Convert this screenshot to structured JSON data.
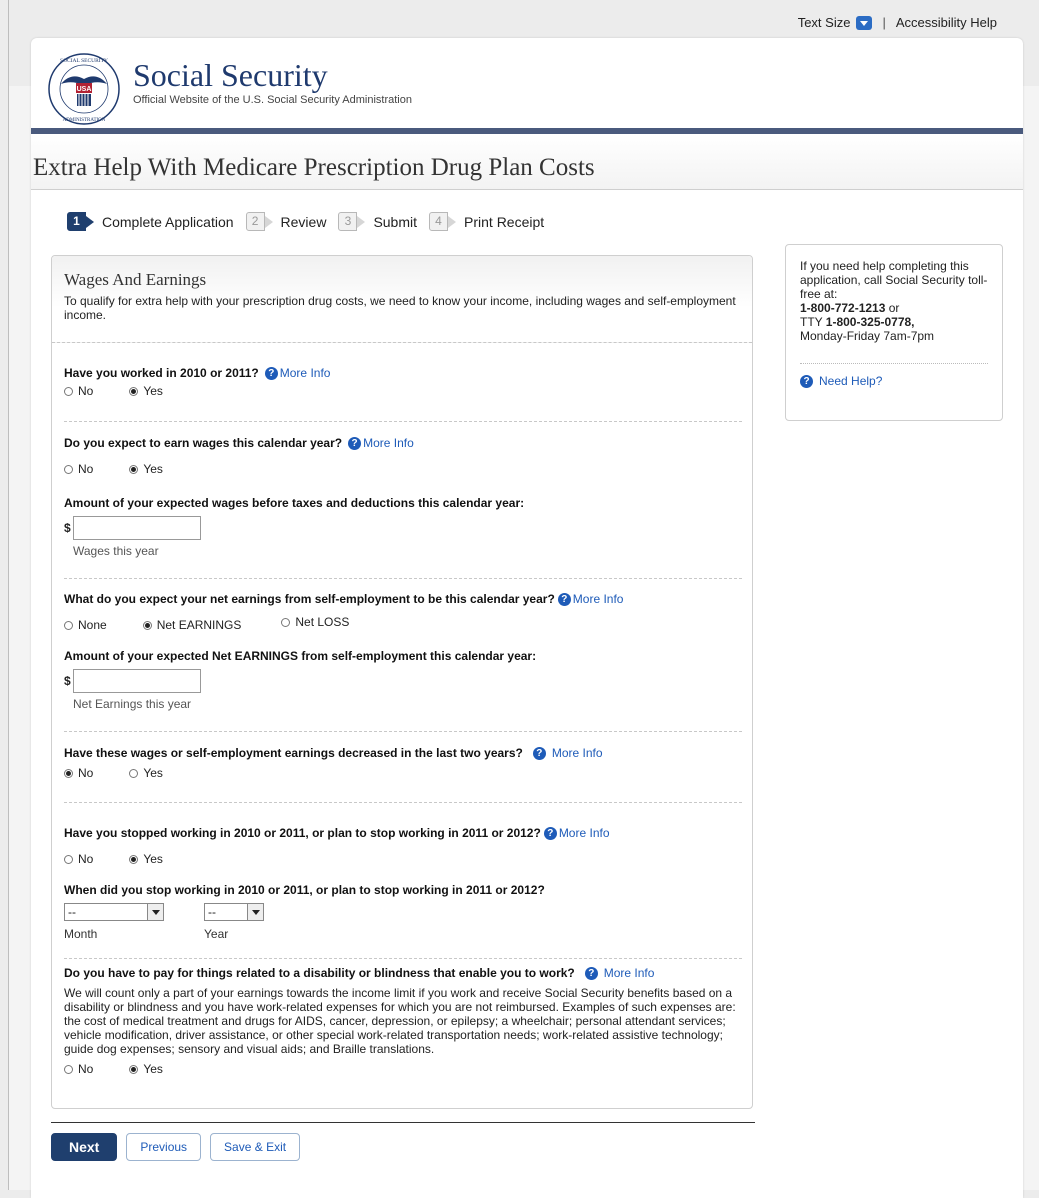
{
  "topbar": {
    "text_size_label": "Text Size",
    "separator": "|",
    "accessibility_label": "Accessibility Help"
  },
  "header": {
    "seal_text_top": "SOCIAL SECURITY",
    "seal_text_bottom": "ADMINISTRATION",
    "seal_usa": "USA",
    "brand_title": "Social Security",
    "brand_subtitle": "Official Website of the U.S. Social Security Administration"
  },
  "page_title": "Extra Help With Medicare Prescription Drug Plan Costs",
  "steps": [
    {
      "num": "1",
      "label": "Complete Application",
      "active": true
    },
    {
      "num": "2",
      "label": "Review",
      "active": false
    },
    {
      "num": "3",
      "label": "Submit",
      "active": false
    },
    {
      "num": "4",
      "label": "Print Receipt",
      "active": false
    }
  ],
  "help": {
    "line1": "If you need help completing this application, call Social Security toll-free at:",
    "phone": "1-800-772-1213",
    "or": " or",
    "tty_prefix": "TTY ",
    "tty": "1-800-325-0778,",
    "hours": "Monday-Friday 7am-7pm",
    "need_help": "Need Help?"
  },
  "section": {
    "title": "Wages And Earnings",
    "intro": "To qualify for extra help with your prescription drug costs, we need to know your income, including wages and self-employment income."
  },
  "more_info": "More Info",
  "questions": {
    "q1": {
      "label": "Have you worked in 2010 or 2011?",
      "options": [
        "No",
        "Yes"
      ],
      "selected": "Yes"
    },
    "q2": {
      "label": "Do you expect to earn wages this calendar year?",
      "options": [
        "No",
        "Yes"
      ],
      "selected": "Yes"
    },
    "q2b": {
      "label": "Amount of your expected wages before taxes and deductions this calendar year:",
      "currency": "$",
      "value": "",
      "hint": "Wages this year"
    },
    "q3": {
      "label": "What do you expect your net earnings from self-employment to be this calendar year?",
      "options": [
        "None",
        "Net EARNINGS",
        "Net LOSS"
      ],
      "selected": "Net EARNINGS"
    },
    "q3b": {
      "label": "Amount of your expected Net EARNINGS from self-employment this calendar year:",
      "currency": "$",
      "value": "",
      "hint": "Net Earnings this year"
    },
    "q4": {
      "label": "Have these wages or self-employment earnings decreased in the last two years?",
      "options": [
        "No",
        "Yes"
      ],
      "selected": "No"
    },
    "q5": {
      "label": "Have you stopped working in 2010 or 2011, or plan to stop working in 2011 or 2012?",
      "options": [
        "No",
        "Yes"
      ],
      "selected": "Yes"
    },
    "q5b": {
      "label": "When did you stop working in 2010 or 2011, or plan to stop working in 2011 or 2012?",
      "month_value": "--",
      "year_value": "--",
      "month_label": "Month",
      "year_label": "Year"
    },
    "q6": {
      "label": "Do you have to pay for things related to a disability or blindness that enable you to work?",
      "description": "We will count only a part of your earnings towards the income limit if you work and receive Social Security benefits based on a disability or blindness and you have work-related expenses for which you are not reimbursed. Examples of such expenses are: the cost of medical treatment and drugs for AIDS, cancer, depression, or epilepsy; a wheelchair; personal attendant services; vehicle modification, driver assistance, or other special work-related transportation needs; work-related assistive technology; guide dog expenses; sensory and visual aids; and Braille translations.",
      "options": [
        "No",
        "Yes"
      ],
      "selected": "Yes"
    }
  },
  "buttons": {
    "next": "Next",
    "previous": "Previous",
    "save_exit": "Save & Exit"
  },
  "icons": {
    "help": "question-circle-icon",
    "dropdown": "chevron-down-icon",
    "seal": "ssa-seal-icon"
  },
  "colors": {
    "navy": "#1f3f6e",
    "link": "#1e5bb8",
    "rule": "#4a5a7d"
  }
}
